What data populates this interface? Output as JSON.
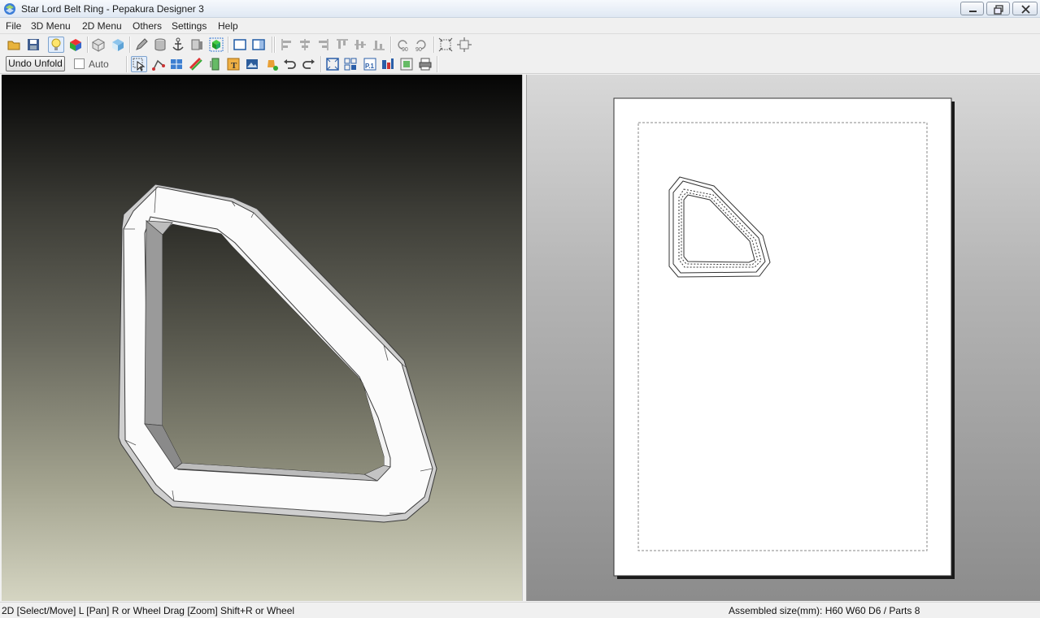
{
  "window": {
    "title": "Star Lord Belt Ring - Pepakura Designer 3"
  },
  "menu": [
    "File",
    "3D Menu",
    "2D Menu",
    "Others",
    "Settings",
    "Help"
  ],
  "toolbar_row1": {
    "icons": [
      "open-icon",
      "save-icon",
      "light-bulb-icon",
      "color-cube-icon",
      "wireframe-cube-icon",
      "textured-cube-icon",
      "edit-pencil-icon",
      "cylinder-icon",
      "anchor-icon",
      "texture-icon",
      "highlight-cube-icon",
      "single-pane-icon",
      "split-pane-icon",
      "align-left-icon",
      "align-center-icon",
      "align-right-icon",
      "align-top-icon",
      "align-middle-icon",
      "align-bottom-icon",
      "rotate-left-90-icon",
      "rotate-right-90-icon",
      "fit-page-icon",
      "expand-page-icon"
    ]
  },
  "toolbar_row2": {
    "undo_unfold_label": "Undo Unfold",
    "auto_label": "Auto",
    "auto_checked": false,
    "icons": [
      "select-arrow-icon",
      "join-edges-icon",
      "flaps-icon",
      "edit-lines-icon",
      "rotate-part-icon",
      "text-icon",
      "image-icon",
      "paint-icon",
      "undo-icon",
      "redo-icon",
      "zoom-fit-icon",
      "arrange-parts-icon",
      "page-number-icon",
      "page-layout-icon",
      "settings-page-icon",
      "print-icon"
    ]
  },
  "status": {
    "left": "2D [Select/Move] L [Pan] R or Wheel Drag [Zoom] Shift+R or Wheel",
    "right": "Assembled size(mm): H60 W60 D6 / Parts 8"
  },
  "colors": {
    "title_bar": "#dfe8f3",
    "chrome": "#f0f0f0",
    "view3d_top": "#050505",
    "view3d_bottom": "#d5d5c2",
    "paper": "#ffffff"
  }
}
